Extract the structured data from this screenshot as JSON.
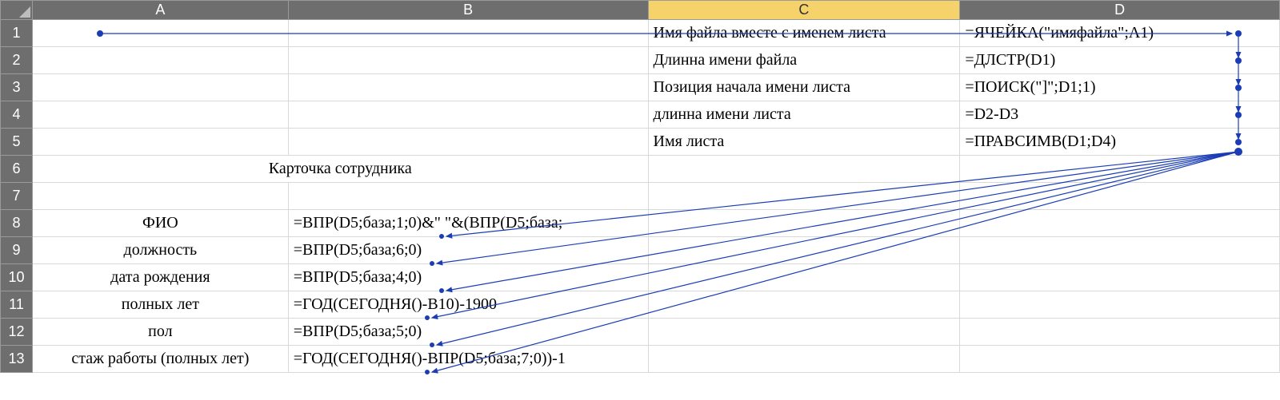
{
  "columns": {
    "corner": "",
    "A": "A",
    "B": "B",
    "C": "C",
    "D": "D"
  },
  "rowHeaders": [
    "1",
    "2",
    "3",
    "4",
    "5",
    "6",
    "7",
    "8",
    "9",
    "10",
    "11",
    "12",
    "13"
  ],
  "cells": {
    "C1": "Имя файла вместе с именем листа",
    "D1": "=ЯЧЕЙКА(\"имяфайла\";A1)",
    "C2": "Длинна имени файла",
    "D2": "=ДЛСТР(D1)",
    "C3": "Позиция начала имени листа",
    "D3": "=ПОИСК(\"]\";D1;1)",
    "C4": "длинна имени листа",
    "D4": "=D2-D3",
    "C5": "Имя листа",
    "D5": "=ПРАВСИМВ(D1;D4)",
    "A6B6": "Карточка сотрудника",
    "A8": "ФИО",
    "B8": "=ВПР(D5;база;1;0)&\" \"&(ВПР(D5;база;",
    "A9": "должность",
    "B9": "=ВПР(D5;база;6;0)",
    "A10": "дата рождения",
    "B10": "=ВПР(D5;база;4;0)",
    "A11": "полных лет",
    "B11": "=ГОД(СЕГОДНЯ()-В10)-1900",
    "A12": "пол",
    "B12": "=ВПР(D5;база;5;0)",
    "A13": "стаж работы (полных лет)",
    "B13": "=ГОД(СЕГОДНЯ()-ВПР(D5;база;7;0))-1"
  }
}
